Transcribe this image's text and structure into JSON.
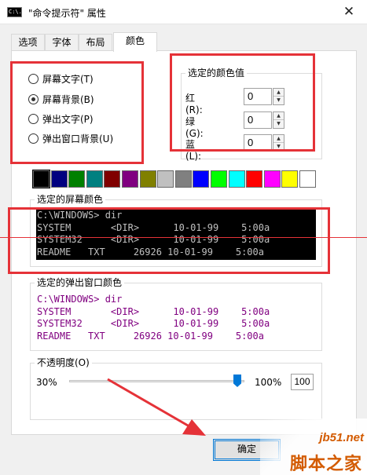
{
  "window": {
    "title": "\"命令提示符\" 属性",
    "close_glyph": "✕",
    "icon": "cmd-icon",
    "icon_text": "C:\\."
  },
  "tabs": [
    {
      "label": "选项",
      "active": false
    },
    {
      "label": "字体",
      "active": false
    },
    {
      "label": "布局",
      "active": false
    },
    {
      "label": "颜色",
      "active": true
    }
  ],
  "target_options": [
    {
      "label": "屏幕文字(T)",
      "checked": false
    },
    {
      "label": "屏幕背景(B)",
      "checked": true
    },
    {
      "label": "弹出文字(P)",
      "checked": false
    },
    {
      "label": "弹出窗口背景(U)",
      "checked": false
    }
  ],
  "color_values": {
    "legend": "选定的颜色值",
    "red": {
      "label": "红(R):",
      "value": "0"
    },
    "green": {
      "label": "绿(G):",
      "value": "0"
    },
    "blue": {
      "label": "蓝(L):",
      "value": "0"
    }
  },
  "palette": [
    "#000000",
    "#000080",
    "#008000",
    "#008080",
    "#800000",
    "#800080",
    "#808000",
    "#c0c0c0",
    "#808080",
    "#0000ff",
    "#00ff00",
    "#00ffff",
    "#ff0000",
    "#ff00ff",
    "#ffff00",
    "#ffffff"
  ],
  "palette_selected_index": 0,
  "screen_colors": {
    "legend": "选定的屏幕颜色",
    "text_color": "#c0c0c0",
    "background_color": "#000000",
    "lines": [
      "C:\\WINDOWS> dir",
      "SYSTEM       <DIR>      10-01-99    5:00a",
      "SYSTEM32     <DIR>      10-01-99    5:00a",
      "README   TXT     26926 10-01-99    5:00a"
    ]
  },
  "popup_colors": {
    "legend": "选定的弹出窗口颜色",
    "text_color": "#800080",
    "background_color": "#ffffff",
    "lines": [
      "C:\\WINDOWS> dir",
      "SYSTEM       <DIR>      10-01-99    5:00a",
      "SYSTEM32     <DIR>      10-01-99    5:00a",
      "README   TXT     26926 10-01-99    5:00a"
    ]
  },
  "opacity": {
    "legend": "不透明度(O)",
    "min_label": "30%",
    "max_label": "100%",
    "value": "100"
  },
  "buttons": {
    "ok": "确定"
  },
  "watermark": {
    "url": "jb51.net",
    "name": "脚本之家"
  },
  "annotation_color": "#e53238",
  "accent_color": "#0078d7"
}
